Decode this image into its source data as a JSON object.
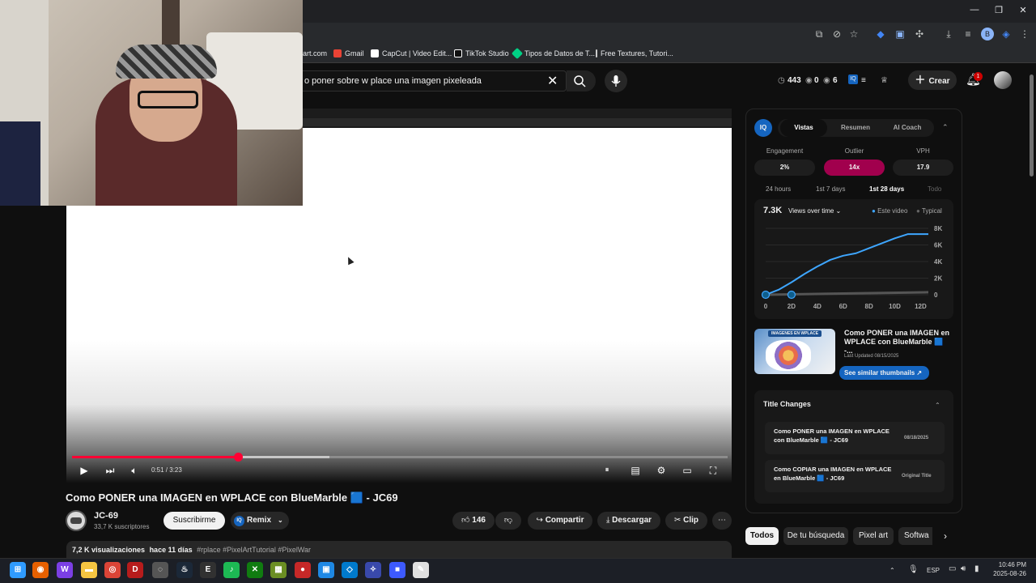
{
  "browser": {
    "bookmarks": [
      "art.com",
      "Gmail",
      "CapCut | Video Edit...",
      "TikTok Studio",
      "Tipos de Datos de T...",
      "Free Textures, Tutori..."
    ],
    "bookmark_colors": [
      "#888888",
      "#ea4335",
      "#ffffff",
      "#ffffff",
      "#00d084",
      "#cccccc"
    ]
  },
  "youtube": {
    "search_query": "o poner sobre w place una imagen pixeleada",
    "stats": {
      "views": "443",
      "a": "0",
      "b": "6"
    },
    "create_label": "Crear",
    "notification_count": "1",
    "player": {
      "time": "0:51 / 3:23",
      "progress": 0.25,
      "buffered": 0.39
    },
    "title": "Como PONER una IMAGEN en WPLACE con BlueMarble 🟦 - JC69",
    "channel": {
      "name": "JC-69",
      "subscribers": "33,7 K suscriptores",
      "subscribe_label": "Suscribirme",
      "remix_label": "Remix"
    },
    "actions": {
      "likes": "146",
      "share": "Compartir",
      "download": "Descargar",
      "clip": "Clip"
    },
    "description": {
      "views": "7,2 K visualizaciones",
      "age": "hace 11 días",
      "tags": "#rplace #PixelArtTutorial #PixelWar"
    },
    "chips": [
      "Todos",
      "De tu búsqueda",
      "Pixel art",
      "Softwa"
    ]
  },
  "panel": {
    "tabs": [
      "Vistas",
      "Resumen",
      "AI Coach"
    ],
    "metrics": [
      {
        "label": "Engagement",
        "value": "2%"
      },
      {
        "label": "Outlier",
        "value": "14x"
      },
      {
        "label": "VPH",
        "value": "17.9"
      }
    ],
    "ranges": [
      "24 hours",
      "1st 7 days",
      "1st 28 days",
      "Todo"
    ],
    "chart_header": {
      "total": "7.3K",
      "selector": "Views over time",
      "legend_a": "Este video",
      "legend_b": "Typical"
    },
    "thumbnail_text": "IMAGENES EN WPLACE",
    "card": {
      "title": "Como PONER una IMAGEN en WPLACE con BlueMarble 🟦 -...",
      "updated": "Last Updated 08/15/2025",
      "button": "See similar thumbnails"
    },
    "title_changes": {
      "heading": "Title Changes",
      "rows": [
        {
          "title": "Como PONER una IMAGEN en WPLACE con BlueMarble 🟦 - JC69",
          "tag": "08/18/2025"
        },
        {
          "title": "Como COPIAR una IMAGEN en WPLACE en BlueMarble 🟦 - JC69",
          "tag": "Original Title"
        }
      ]
    }
  },
  "chart_data": {
    "type": "line",
    "x_ticks": [
      "0",
      "2D",
      "4D",
      "6D",
      "8D",
      "10D",
      "12D"
    ],
    "y_ticks": [
      "0",
      "2K",
      "4K",
      "6K",
      "8K"
    ],
    "ylim": [
      0,
      8000
    ],
    "series": [
      {
        "name": "Este video",
        "color": "#3ea6ff",
        "x": [
          0,
          1,
          2,
          3,
          4,
          5,
          6,
          7,
          8,
          9,
          10,
          11,
          12,
          12.6
        ],
        "values": [
          0,
          600,
          1500,
          2500,
          3400,
          4200,
          4700,
          5000,
          5600,
          6200,
          6800,
          7300,
          7300,
          7300
        ]
      },
      {
        "name": "Typical",
        "color": "#555555",
        "x": [
          0,
          12.6
        ],
        "values": [
          0,
          300
        ]
      }
    ]
  },
  "taskbar": {
    "lang": "ESP",
    "time": "10:46 PM",
    "date": "2025-08-26",
    "apps": [
      {
        "name": "start",
        "color": "#2f9bff",
        "glyph": "⊞"
      },
      {
        "name": "firefox",
        "color": "#e66000",
        "glyph": "◉"
      },
      {
        "name": "app",
        "color": "#7b3fe4",
        "glyph": "W"
      },
      {
        "name": "explorer",
        "color": "#f5c542",
        "glyph": "▬"
      },
      {
        "name": "chrome",
        "color": "#db4437",
        "glyph": "◎"
      },
      {
        "name": "davinci",
        "color": "#b71c1c",
        "glyph": "D"
      },
      {
        "name": "app2",
        "color": "#555555",
        "glyph": "◌"
      },
      {
        "name": "steam",
        "color": "#1b2838",
        "glyph": "♨"
      },
      {
        "name": "epic",
        "color": "#313131",
        "glyph": "E"
      },
      {
        "name": "spotify",
        "color": "#1db954",
        "glyph": "♪"
      },
      {
        "name": "xbox",
        "color": "#107c10",
        "glyph": "✕"
      },
      {
        "name": "minecraft",
        "color": "#6b8e23",
        "glyph": "▦"
      },
      {
        "name": "app3",
        "color": "#c62828",
        "glyph": "●"
      },
      {
        "name": "app4",
        "color": "#1e88e5",
        "glyph": "▣"
      },
      {
        "name": "vscode",
        "color": "#007acc",
        "glyph": "◇"
      },
      {
        "name": "app5",
        "color": "#3949ab",
        "glyph": "✧"
      },
      {
        "name": "roblox",
        "color": "#3d5afe",
        "glyph": "■"
      },
      {
        "name": "app6",
        "color": "#e0e0e0",
        "glyph": "✎"
      }
    ]
  }
}
